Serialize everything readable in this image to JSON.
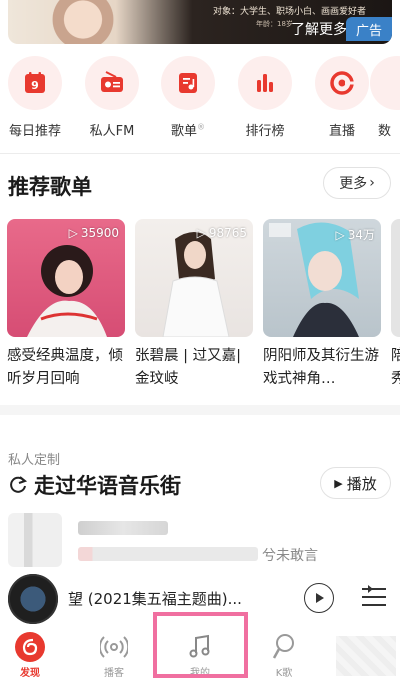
{
  "banner": {
    "line1": "对象：大学生、职场小白、画画爱好者",
    "line2": "年龄：18岁",
    "more": "了解更多",
    "ad": "广告"
  },
  "quick_entries": [
    {
      "label": "每日推荐",
      "icon": "calendar-icon",
      "badge": "9"
    },
    {
      "label": "私人FM",
      "icon": "radio-icon"
    },
    {
      "label": "歌单",
      "icon": "playlist-icon",
      "sup": "®"
    },
    {
      "label": "排行榜",
      "icon": "chart-bars-icon"
    },
    {
      "label": "直播",
      "icon": "live-icon"
    },
    {
      "label": "数",
      "icon": "partial-icon"
    }
  ],
  "recommend": {
    "title": "推荐歌单",
    "more": "更多",
    "cards": [
      {
        "count": "35900",
        "name": "感受经典温度，倾听岁月回响"
      },
      {
        "count": "98765",
        "name": "张碧晨 | 过又嘉| 金玟岐"
      },
      {
        "count": "34万",
        "name": "阴阳师及其衍生游戏式神角…"
      },
      {
        "count": "",
        "name": "陪秀"
      }
    ]
  },
  "custom": {
    "sub_label": "私人定制",
    "title": "走过华语音乐街",
    "play": "播放",
    "song_tail": "兮未敢言"
  },
  "player": {
    "title": "望 (2021集五福主题曲)..."
  },
  "tabs": [
    {
      "label": "发现",
      "icon": "discover-icon",
      "active": true
    },
    {
      "label": "播客",
      "icon": "podcast-icon"
    },
    {
      "label": "我的",
      "icon": "music-note-icon"
    },
    {
      "label": "K歌",
      "icon": "k-song-icon"
    }
  ],
  "colors": {
    "accent": "#e8392f",
    "pink_bg": "#fdeeed",
    "ad_blue": "#3a81c7",
    "highlight": "#f06fa0"
  }
}
